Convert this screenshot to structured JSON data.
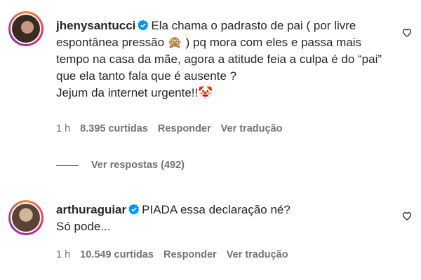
{
  "comments": [
    {
      "username": "jhenysantucci",
      "lines": [
        "Ela chama o padrasto de pai ( por livre",
        "espontânea pressão 🙊 ) pq mora com eles e passa mais",
        "tempo na casa da mãe, agora a atitude feia a culpa é do “pai”",
        "que ela tanto fala que é ausente ?",
        "Jejum da internet urgente!!🤡"
      ],
      "time": "1 h",
      "likes": "8.395 curtidas",
      "reply": "Responder",
      "translate": "Ver tradução"
    },
    {
      "username": "arthuraguiar",
      "lines": [
        "PIADA essa declaração né?",
        "Só pode..."
      ],
      "time": "1 h",
      "likes": "10.549 curtidas",
      "reply": "Responder",
      "translate": "Ver tradução"
    }
  ],
  "view_replies": "Ver respostas (492)",
  "colors": {
    "verified": "#0095f6",
    "secondary": "#737373",
    "text": "#262626"
  },
  "icons": {
    "verified": "verified-badge-icon",
    "like": "heart-outline-icon"
  }
}
